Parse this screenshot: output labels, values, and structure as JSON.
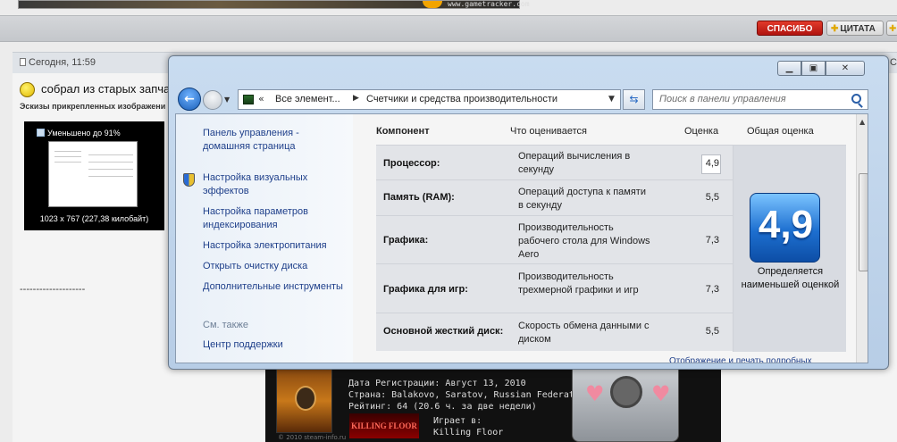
{
  "forum": {
    "banner_url": "www.gametracker.com",
    "thanks_button": "СПАСИБО",
    "quote_button": "ЦИТАТА",
    "post_date": "Сегодня, 11:59",
    "post_date_cut": "Се",
    "post_text": "собрал из старых запча",
    "thumbs_label": "Эскизы прикрепленных изображени",
    "thumb_caption": "Уменьшено до 91%",
    "thumb_size": "1023 x 767 (227,38 килобайт)",
    "separator": "--------------------"
  },
  "signature": {
    "lines": [
      "Дата Регистрации: Август 13, 2010",
      "Страна: Balakovo, Saratov, Russian Federation",
      "Рейтинг: 64 (20.6 ч. за две недели)"
    ],
    "game_logo": "KILLING FLOOR",
    "playing_label": "Играет в:",
    "playing_game": "Killing Floor",
    "copyright": "© 2010 steam-info.ru"
  },
  "window": {
    "address": {
      "crumb1": "Все элемент...",
      "crumb2": "Счетчики и средства производительности"
    },
    "search_placeholder": "Поиск в панели управления",
    "nav": [
      "Панель управления - домашняя страница",
      "Настройка визуальных эффектов",
      "Настройка параметров индексирования",
      "Настройка электропитания",
      "Открыть очистку диска",
      "Дополнительные инструменты"
    ],
    "see_also": "См. также",
    "support": "Центр поддержки",
    "table": {
      "headers": [
        "Компонент",
        "Что оценивается",
        "Оценка",
        "Общая оценка"
      ],
      "rows": [
        {
          "name": "Процессор:",
          "desc": "Операций вычисления в секунду",
          "score": "4,9"
        },
        {
          "name": "Память (RAM):",
          "desc": "Операций доступа к памяти в секунду",
          "score": "5,5"
        },
        {
          "name": "Графика:",
          "desc": "Производительность рабочего стола для Windows Aero",
          "score": "7,3"
        },
        {
          "name": "Графика для игр:",
          "desc": "Производительность трехмерной графики и игр",
          "score": "7,3"
        },
        {
          "name": "Основной жесткий диск:",
          "desc": "Скорость обмена данными с диском",
          "score": "5,5"
        }
      ],
      "overall": "4,9",
      "overall_caption": "Определяется наименьшей оценкой"
    },
    "bottom_link": "Отображение и печать подробных"
  },
  "colors": {
    "accent": "#1d6fd0",
    "thanks": "#c0201a",
    "link": "#1e3f8a"
  }
}
